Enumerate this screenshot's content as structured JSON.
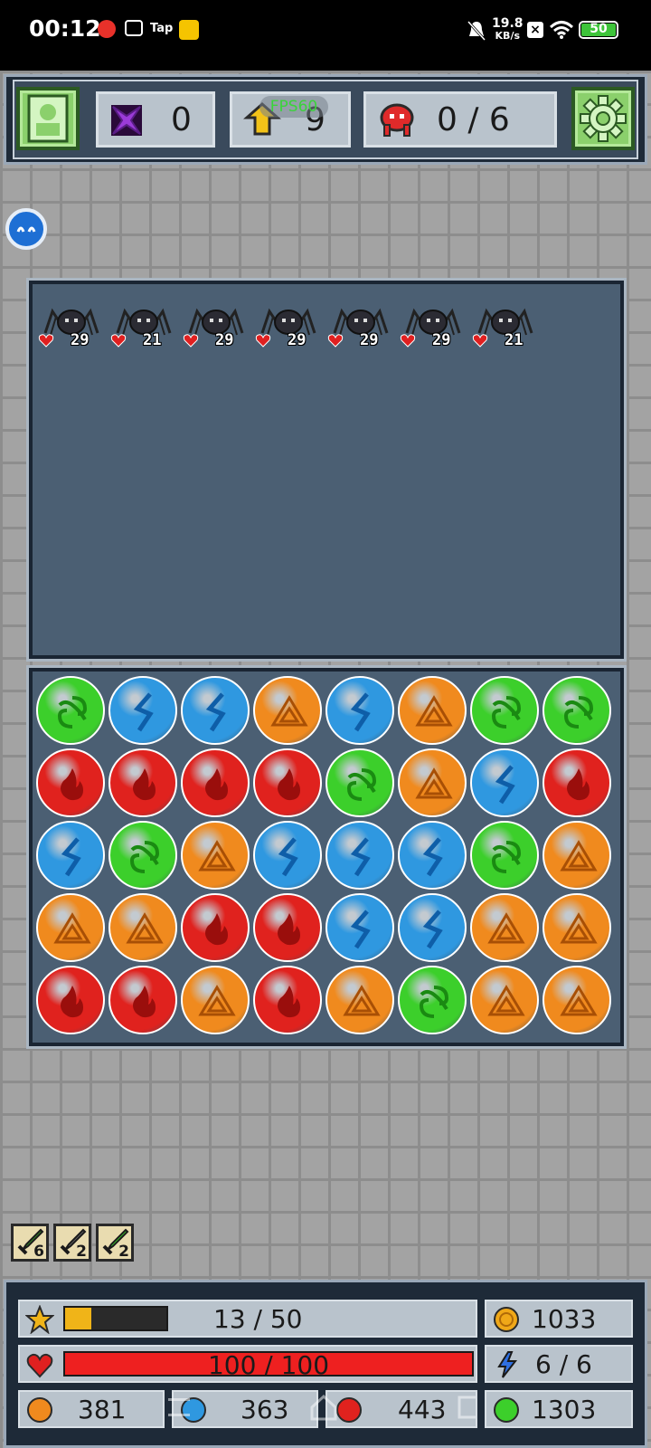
{
  "status_bar": {
    "time": "00:12",
    "net_speed_value": "19.8",
    "net_speed_unit": "KB/s",
    "battery": "50",
    "app_icons": [
      "netease-music-icon",
      "bilibili-icon",
      "taptap-icon",
      "game-badge-icon"
    ]
  },
  "top_hud": {
    "gems": "0",
    "level": "9",
    "enemies_killed": "0 / 6",
    "fps_overlay": "FPS60"
  },
  "enemies": [
    {
      "name": "spider",
      "hp": "29"
    },
    {
      "name": "spider",
      "hp": "21"
    },
    {
      "name": "spider",
      "hp": "29"
    },
    {
      "name": "spider",
      "hp": "29"
    },
    {
      "name": "spider",
      "hp": "29"
    },
    {
      "name": "spider",
      "hp": "29"
    },
    {
      "name": "spider",
      "hp": "21"
    }
  ],
  "board": [
    [
      "green",
      "blue",
      "blue",
      "orange",
      "blue",
      "orange",
      "green",
      "green"
    ],
    [
      "red",
      "red",
      "red",
      "red",
      "green",
      "orange",
      "blue",
      "red"
    ],
    [
      "blue",
      "green",
      "orange",
      "blue",
      "blue",
      "blue",
      "green",
      "orange"
    ],
    [
      "orange",
      "orange",
      "red",
      "red",
      "blue",
      "blue",
      "orange",
      "orange"
    ],
    [
      "red",
      "red",
      "orange",
      "red",
      "orange",
      "green",
      "orange",
      "orange"
    ]
  ],
  "orb_colors": {
    "green": "#3ccf2b",
    "blue": "#2f98e0",
    "orange": "#f08a1e",
    "red": "#e0221e"
  },
  "skills": [
    {
      "icon": "nature-sword-icon",
      "count": "6"
    },
    {
      "icon": "stone-sword-icon",
      "count": "2"
    },
    {
      "icon": "green-sword-icon",
      "count": "2"
    }
  ],
  "player": {
    "xp_text": "13 / 50",
    "xp_fraction": 0.26,
    "hp_text": "100 / 100",
    "hp_fraction": 1.0,
    "coins": "1033",
    "mana_text": "6 / 6",
    "orange_count": "381",
    "blue_count": "363",
    "red_count": "443",
    "green_count": "1303"
  },
  "accent": {
    "xp_bar": "#f0b418",
    "hp_bar": "#ee2020",
    "panel": "#4b5f73",
    "frame": "#1e2a38"
  }
}
